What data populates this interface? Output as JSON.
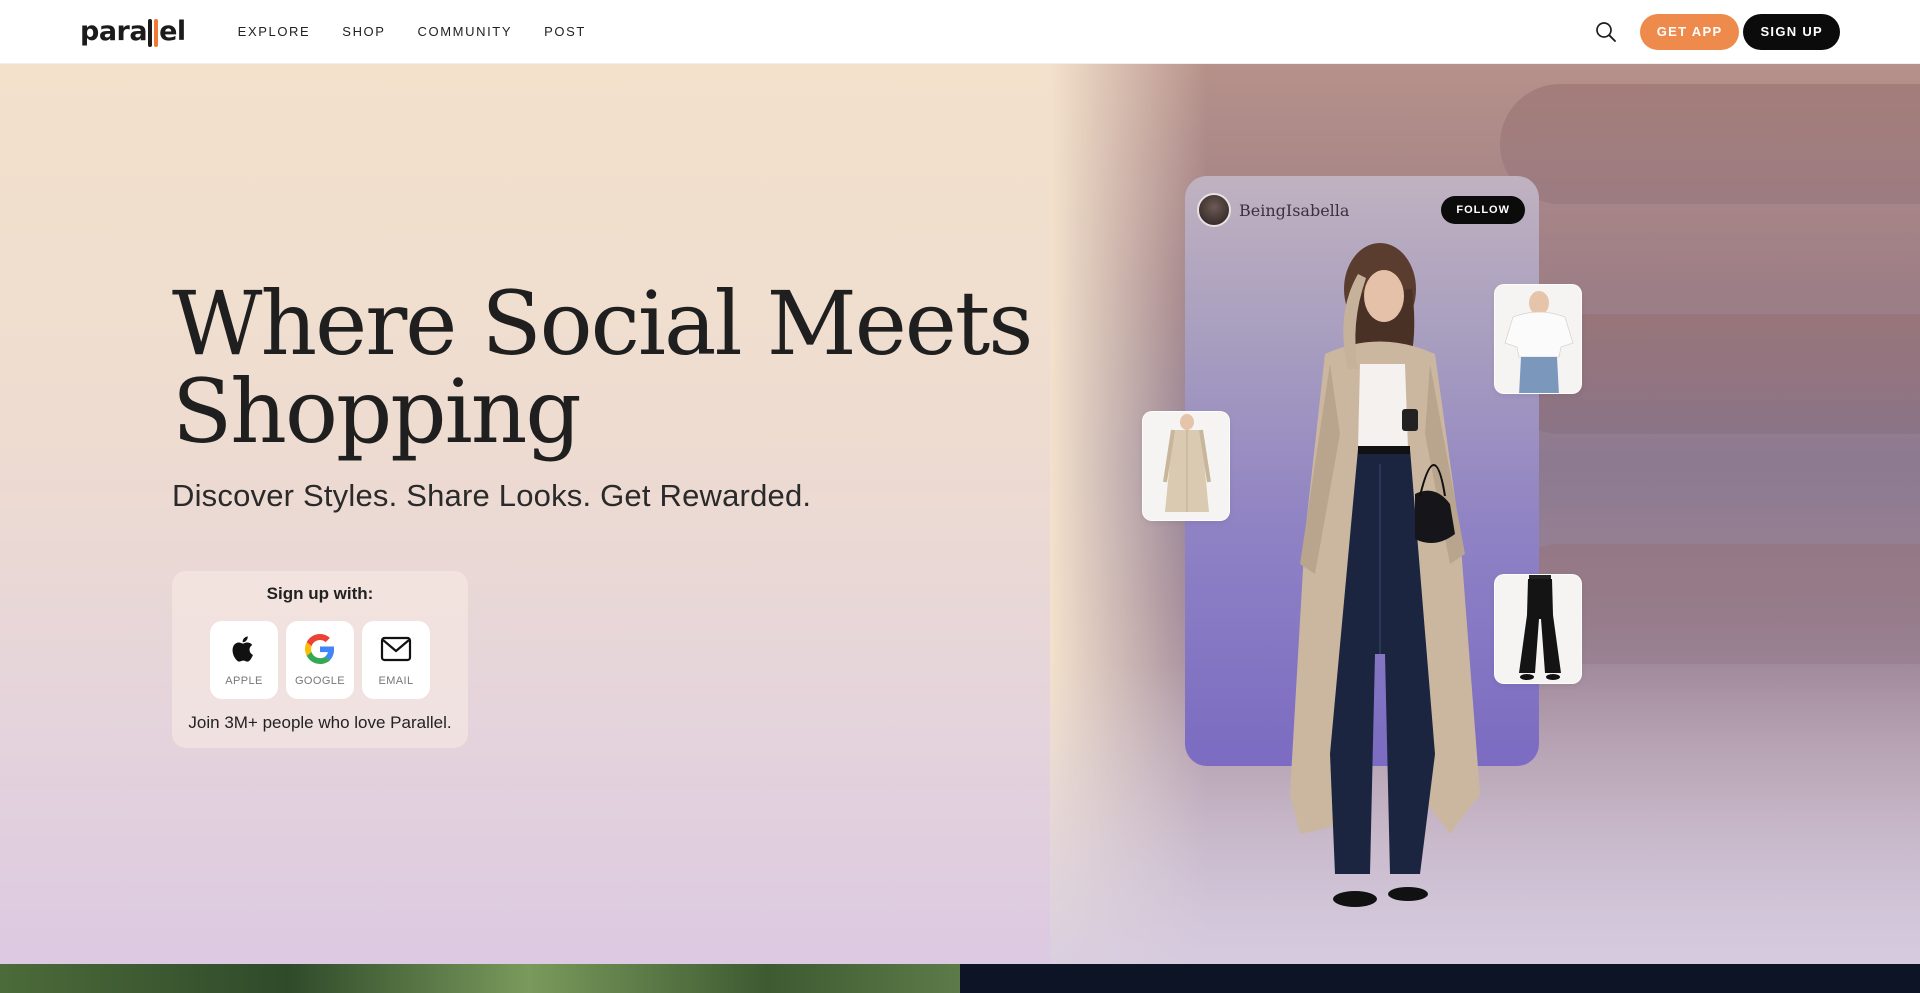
{
  "nav": {
    "logo": "parallel",
    "links": [
      "EXPLORE",
      "SHOP",
      "COMMUNITY",
      "POST"
    ],
    "get_app": "GET APP",
    "sign_up": "SIGN UP",
    "search_icon": "search-icon"
  },
  "hero": {
    "headline_line1": "Where Social Meets",
    "headline_line2": "Shopping",
    "subhead": "Discover Styles. Share Looks. Get Rewarded.",
    "signup": {
      "title": "Sign up with:",
      "options": [
        {
          "label": "APPLE",
          "icon": "apple-icon"
        },
        {
          "label": "GOOGLE",
          "icon": "google-icon"
        },
        {
          "label": "EMAIL",
          "icon": "email-icon"
        }
      ],
      "join_text": "Join 3M+ people who love Parallel."
    }
  },
  "post": {
    "username": "BeingIsabella",
    "follow": "FOLLOW",
    "products": [
      "white-crop-tee",
      "beige-trench-coat",
      "black-flared-pants"
    ]
  },
  "colors": {
    "accent_orange": "#ee8a4c",
    "dark_button": "#0b0b0b",
    "hero_bg_top": "#f3e1cc",
    "post_card_purple": "#8f82c4"
  }
}
